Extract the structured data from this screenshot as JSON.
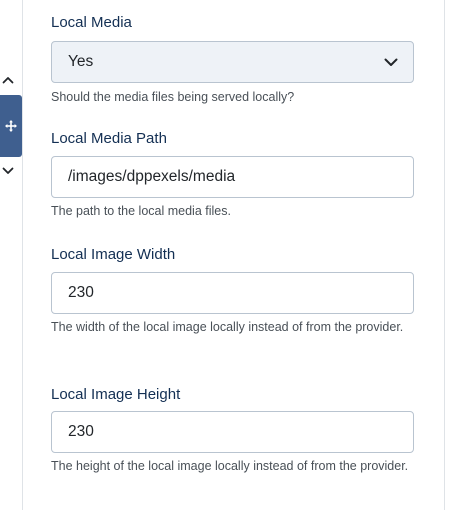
{
  "fields": [
    {
      "label": "Local Media",
      "type": "select",
      "value": "Yes",
      "help": "Should the media files being served locally?"
    },
    {
      "label": "Local Media Path",
      "type": "text",
      "value": "/images/dppexels/media",
      "help": "The path to the local media files."
    },
    {
      "label": "Local Image Width",
      "type": "text",
      "value": "230",
      "help": "The width of the local image locally instead of from the provider."
    },
    {
      "label": "Local Image Height",
      "type": "text",
      "value": "230",
      "help": "The height of the local image locally instead of from the provider."
    }
  ],
  "icons": {
    "move_up": "chevron-up-icon",
    "move_handle": "move-arrows-icon",
    "move_down": "chevron-down-icon",
    "select_caret": "chevron-down-icon"
  },
  "colors": {
    "label": "#132f53",
    "handle": "#3f5f8f",
    "select_bg": "#eef2f7",
    "border": "#b9c4d0",
    "help": "#495057"
  }
}
